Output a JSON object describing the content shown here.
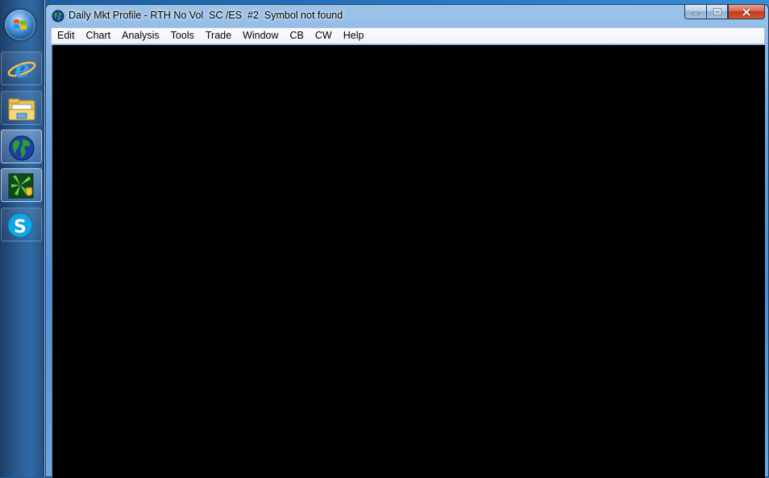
{
  "taskbar": {
    "start_button": "start-orb",
    "items": [
      {
        "name": "internet-explorer",
        "icon": "ie-icon",
        "active": false
      },
      {
        "name": "windows-explorer",
        "icon": "folder-icon",
        "active": false
      },
      {
        "name": "trading-platform",
        "icon": "globe-icon",
        "active": true
      },
      {
        "name": "security-app",
        "icon": "shield-icon",
        "active": true
      },
      {
        "name": "skype",
        "icon": "skype-icon",
        "active": false
      }
    ]
  },
  "window": {
    "title": "Daily Mkt Profile - RTH No Vol  SC /ES  #2  Symbol not found",
    "icon": "globe-icon",
    "caption_buttons": [
      "minimize",
      "maximize",
      "close"
    ],
    "menu": [
      "Edit",
      "Chart",
      "Analysis",
      "Tools",
      "Trade",
      "Window",
      "CB",
      "CW",
      "Help"
    ],
    "client_background": "#000000"
  }
}
